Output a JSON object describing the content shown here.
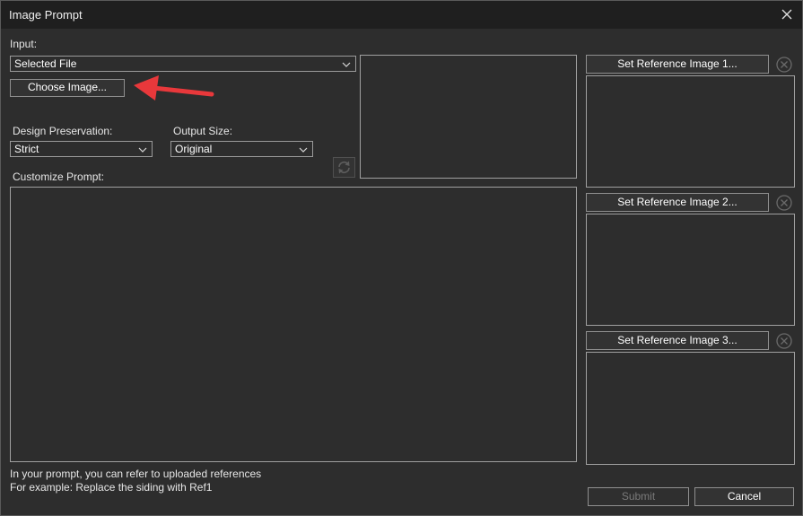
{
  "window": {
    "title": "Image Prompt"
  },
  "input": {
    "label": "Input:",
    "source_value": "Selected File",
    "choose_button": "Choose Image..."
  },
  "design_preservation": {
    "label": "Design Preservation:",
    "value": "Strict"
  },
  "output_size": {
    "label": "Output Size:",
    "value": "Original"
  },
  "prompt": {
    "label": "Customize Prompt:",
    "value": ""
  },
  "references": [
    {
      "button": "Set Reference Image 1..."
    },
    {
      "button": "Set Reference Image 2..."
    },
    {
      "button": "Set Reference Image 3..."
    }
  ],
  "hint": {
    "line1": "In your prompt, you can refer to uploaded references",
    "line2": "For example: Replace the siding with Ref1"
  },
  "footer": {
    "submit": "Submit",
    "cancel": "Cancel"
  },
  "colors": {
    "background": "#2d2d2d",
    "titlebar": "#1f1f1f",
    "annotation_arrow": "#e8383b"
  }
}
